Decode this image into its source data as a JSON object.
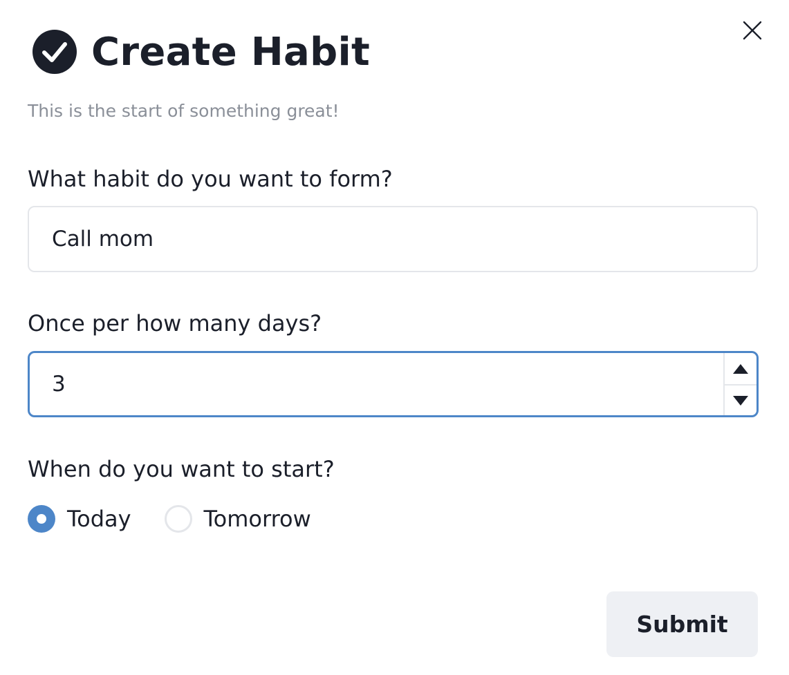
{
  "dialog": {
    "title": "Create Habit",
    "subtitle": "This is the start of something great!",
    "title_icon": "check-circle-icon",
    "close_icon": "close-icon"
  },
  "habit_field": {
    "label": "What habit do you want to form?",
    "value": "Call mom"
  },
  "frequency_field": {
    "label": "Once per how many days?",
    "value": "3",
    "increment_icon": "triangle-up-icon",
    "decrement_icon": "triangle-down-icon"
  },
  "start_field": {
    "label": "When do you want to start?",
    "options": [
      {
        "label": "Today",
        "selected": true
      },
      {
        "label": "Tomorrow",
        "selected": false
      }
    ]
  },
  "actions": {
    "submit_label": "Submit"
  },
  "colors": {
    "accent": "#4d86c8",
    "text": "#1b1f2a",
    "muted_text": "#8a8f98",
    "border": "#e4e6ea",
    "button_bg": "#eef0f4"
  }
}
